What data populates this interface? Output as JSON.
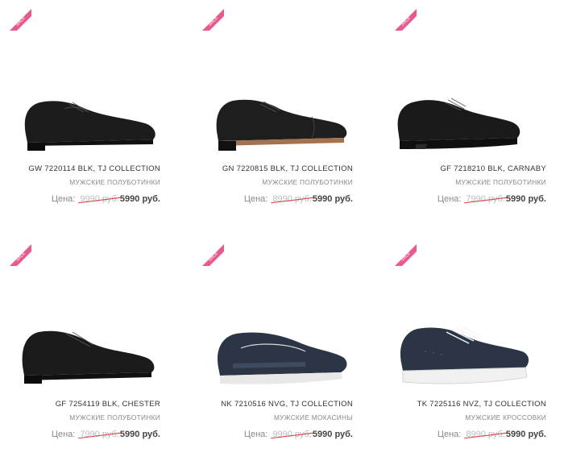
{
  "badge_text": "SALE",
  "colors": {
    "sale_badge": "#e85a8f",
    "old_price_strike": "#d63a3a",
    "shoe_black": "#1c1c1c",
    "shoe_navy": "#2c3545"
  },
  "products": [
    {
      "title": "GW 7220114 BLK, TJ COLLECTION",
      "category": "МУЖСКИЕ ПОЛУБОТИНКИ",
      "price_label": "Цена:",
      "old_price": "9990 руб.",
      "new_price": "5990 руб.",
      "icon": "oxford-shoe-icon"
    },
    {
      "title": "GN 7220815 BLK, TJ COLLECTION",
      "category": "МУЖСКИЕ ПОЛУБОТИНКИ",
      "price_label": "Цена:",
      "old_price": "8990 руб.",
      "new_price": "5990 руб.",
      "icon": "captoe-oxford-shoe-icon"
    },
    {
      "title": "GF 7218210 BLK, CARNABY",
      "category": "МУЖСКИЕ ПОЛУБОТИНКИ",
      "price_label": "Цена:",
      "old_price": "7990 руб.",
      "new_price": "5990 руб.",
      "icon": "casual-lace-shoe-icon"
    },
    {
      "title": "GF 7254119 BLK, CHESTER",
      "category": "МУЖСКИЕ ПОЛУБОТИНКИ",
      "price_label": "Цена:",
      "old_price": "7990 руб.",
      "new_price": "5990 руб.",
      "icon": "derby-shoe-icon"
    },
    {
      "title": "NK 7210516 NVG, TJ COLLECTION",
      "category": "МУЖСКИЕ МОКАСИНЫ",
      "price_label": "Цена:",
      "old_price": "9990 руб.",
      "new_price": "5990 руб.",
      "icon": "moccasin-icon"
    },
    {
      "title": "TK 7225116 NVZ, TJ COLLECTION",
      "category": "МУЖСКИЕ КРОССОВКИ",
      "price_label": "Цена:",
      "old_price": "8990 руб.",
      "new_price": "5990 руб.",
      "icon": "sneaker-icon"
    }
  ]
}
